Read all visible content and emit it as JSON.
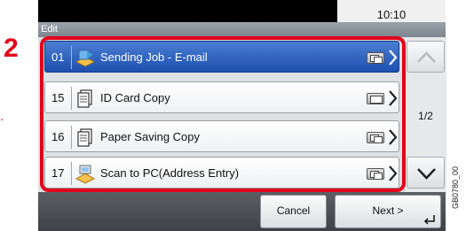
{
  "step_number": "2",
  "status_bar": {
    "time": "10:10"
  },
  "screen_title": "Edit",
  "list": {
    "items": [
      {
        "number": "01",
        "name": "Sending Job - E-mail",
        "icon": "send-job-icon",
        "type_icon": "multi-page-icon",
        "selected": true
      },
      {
        "number": "15",
        "name": "ID Card Copy",
        "icon": "copy-job-icon",
        "type_icon": "single-page-icon",
        "selected": false
      },
      {
        "number": "16",
        "name": "Paper Saving Copy",
        "icon": "copy-job-icon",
        "type_icon": "multi-page-icon",
        "selected": false
      },
      {
        "number": "17",
        "name": "Scan to PC(Address Entry)",
        "icon": "scan-to-pc-icon",
        "type_icon": "multi-page-icon",
        "selected": false
      }
    ]
  },
  "pagination": {
    "indicator": "1/2"
  },
  "buttons": {
    "cancel": "Cancel",
    "next": "Next >"
  },
  "figure_code": "GB0780_00",
  "colors": {
    "highlight": "#e2001a",
    "selected_row": "#1d4fb0",
    "title_bar": "#8a939b"
  }
}
